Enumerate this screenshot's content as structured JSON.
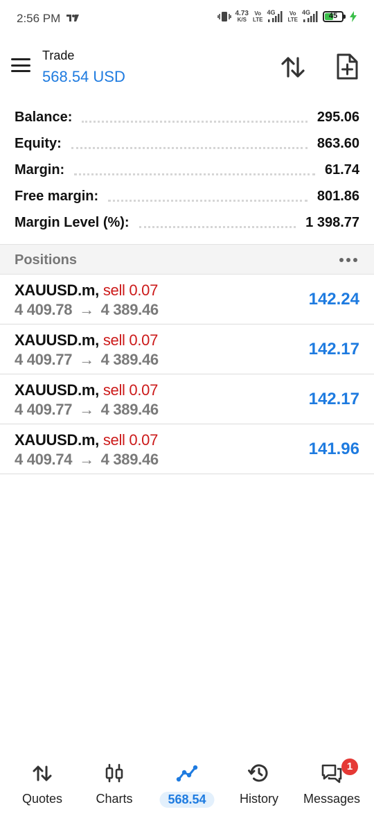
{
  "status_bar": {
    "time": "2:56 PM",
    "net_speed_value": "4.73",
    "net_speed_unit": "K/S",
    "sim1_label_top": "Vo",
    "sim1_label_bottom": "LTE",
    "sim1_network": "4G",
    "sim2_label_top": "Vo",
    "sim2_label_bottom": "LTE",
    "sim2_network": "4G",
    "battery_level": "45",
    "battery_fraction": 0.45,
    "battery_color": "#3bbf4a"
  },
  "header": {
    "title": "Trade",
    "balance_display": "568.54 USD",
    "icons": [
      "menu-icon",
      "sort-icon",
      "new-order-icon"
    ]
  },
  "summary": {
    "rows": [
      {
        "label": "Balance:",
        "value": "295.06"
      },
      {
        "label": "Equity:",
        "value": "863.60"
      },
      {
        "label": "Margin:",
        "value": "61.74"
      },
      {
        "label": "Free margin:",
        "value": "801.86"
      },
      {
        "label": "Margin Level (%):",
        "value": "1 398.77"
      }
    ]
  },
  "positions": {
    "title": "Positions",
    "items": [
      {
        "symbol": "XAUUSD.m,",
        "side": "sell 0.07",
        "open_price": "4 409.78",
        "arrow": "→",
        "current_price": "4 389.46",
        "profit": "142.24"
      },
      {
        "symbol": "XAUUSD.m,",
        "side": "sell 0.07",
        "open_price": "4 409.77",
        "arrow": "→",
        "current_price": "4 389.46",
        "profit": "142.17"
      },
      {
        "symbol": "XAUUSD.m,",
        "side": "sell 0.07",
        "open_price": "4 409.77",
        "arrow": "→",
        "current_price": "4 389.46",
        "profit": "142.17"
      },
      {
        "symbol": "XAUUSD.m,",
        "side": "sell 0.07",
        "open_price": "4 409.74",
        "arrow": "→",
        "current_price": "4 389.46",
        "profit": "141.96"
      }
    ]
  },
  "bottom_nav": {
    "items": [
      {
        "label": "Quotes",
        "icon": "quotes-icon"
      },
      {
        "label": "Charts",
        "icon": "charts-icon"
      },
      {
        "label": "568.54",
        "icon": "trade-icon",
        "active": true
      },
      {
        "label": "History",
        "icon": "history-icon"
      },
      {
        "label": "Messages",
        "icon": "messages-icon",
        "badge": "1"
      }
    ]
  },
  "colors": {
    "accent": "#1e7be0",
    "sell": "#cc1a1a",
    "badge": "#e53935"
  }
}
